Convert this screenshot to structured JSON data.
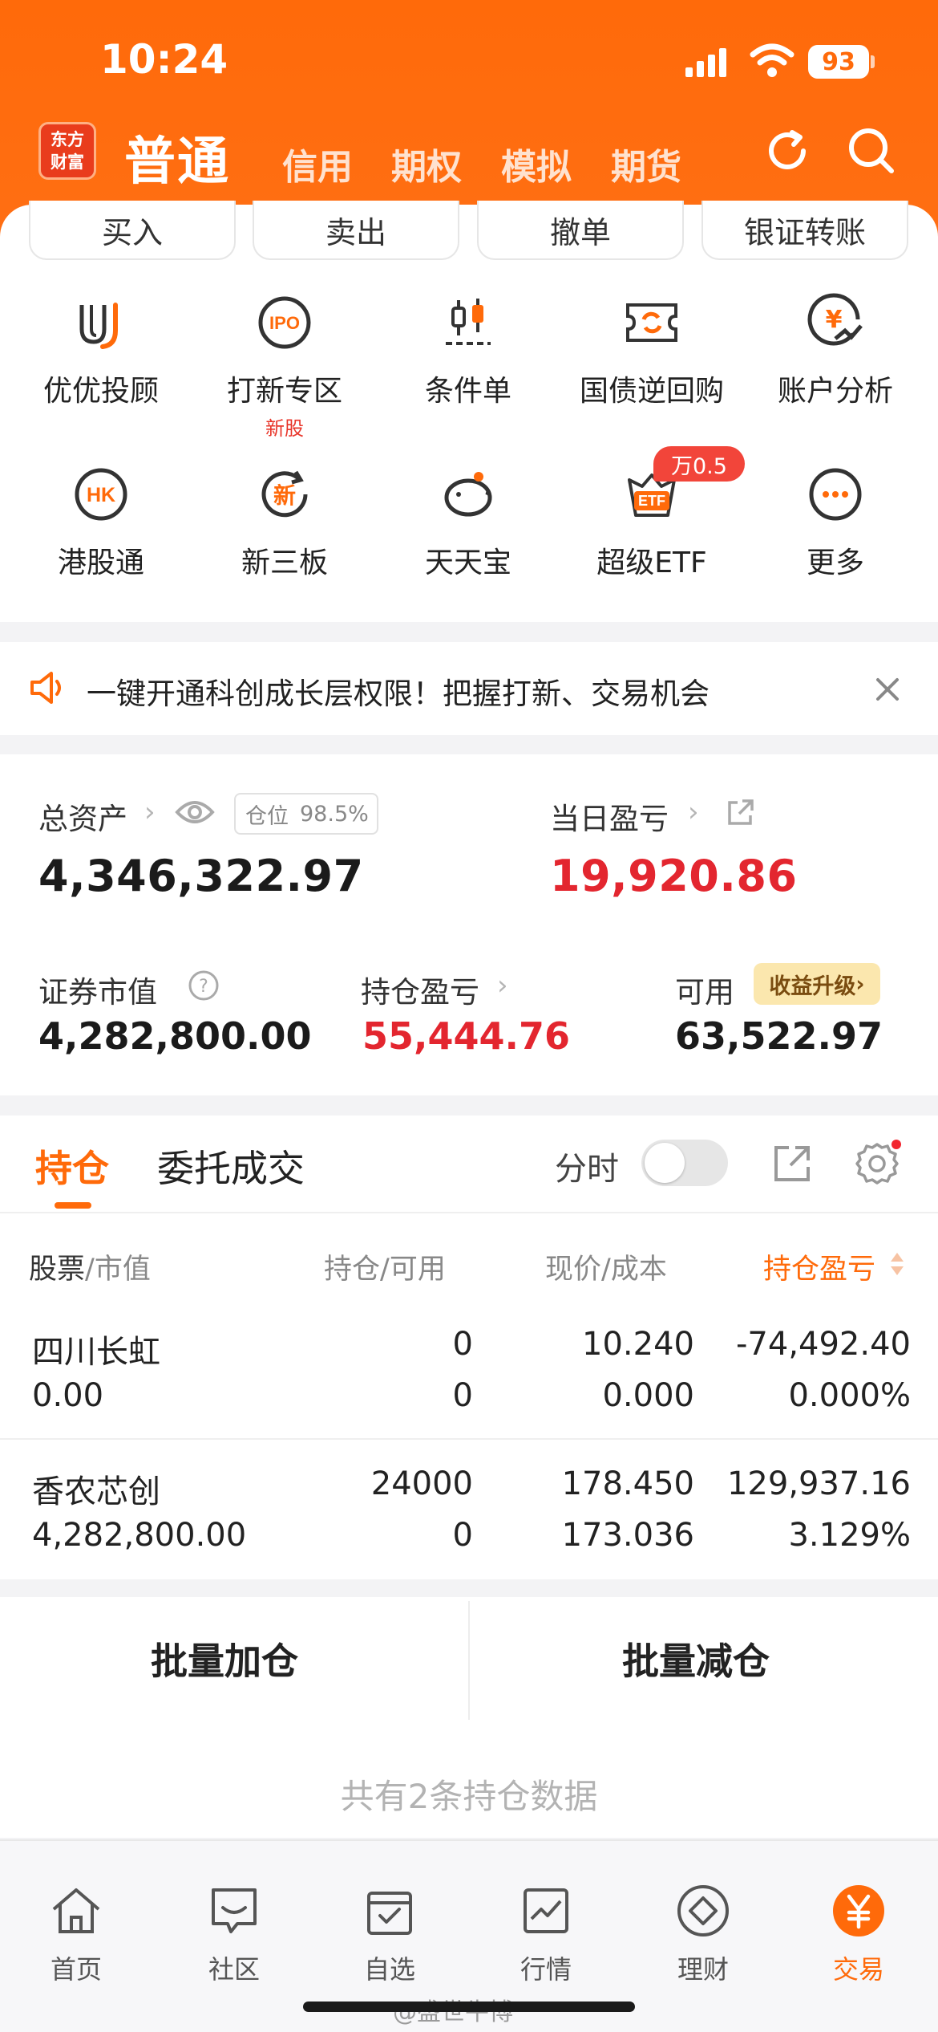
{
  "status_bar": {
    "time": "10:24",
    "battery": "93"
  },
  "header": {
    "logo_line1": "东方",
    "logo_line2": "财富",
    "active_tab": "普通",
    "tabs": [
      "信用",
      "期权",
      "模拟",
      "期货"
    ]
  },
  "quick_buttons": [
    "买入",
    "卖出",
    "撤单",
    "银证转账"
  ],
  "features": [
    {
      "label": "优优投顾",
      "icon": "uu-advisor-icon"
    },
    {
      "label": "打新专区",
      "sub": "新股",
      "icon": "ipo-icon"
    },
    {
      "label": "条件单",
      "icon": "candlestick-icon"
    },
    {
      "label": "国债逆回购",
      "icon": "repo-ticket-icon"
    },
    {
      "label": "账户分析",
      "icon": "yen-chart-icon"
    },
    {
      "label": "港股通",
      "icon": "hk-icon"
    },
    {
      "label": "新三板",
      "icon": "new-board-icon"
    },
    {
      "label": "天天宝",
      "icon": "piggy-bank-icon"
    },
    {
      "label": "超级ETF",
      "badge": "万0.5",
      "icon": "etf-icon"
    },
    {
      "label": "更多",
      "icon": "more-icon"
    }
  ],
  "notice": {
    "text": "一键开通科创成长层权限！把握打新、交易机会"
  },
  "assets": {
    "total_label": "总资产",
    "position_label": "仓位",
    "position_value": "98.5%",
    "total_value": "4,346,322.97",
    "daily_pl_label": "当日盈亏",
    "daily_pl_value": "19,920.86",
    "market_value_label": "证券市值",
    "market_value": "4,282,800.00",
    "holding_pl_label": "持仓盈亏",
    "holding_pl_value": "55,444.76",
    "available_label": "可用",
    "available_value": "63,522.97",
    "upgrade_label": "收益升级"
  },
  "holdings": {
    "tab_active": "持仓",
    "tab_other": "委托成交",
    "toggle_label": "分时",
    "columns": {
      "stock": "股票",
      "market_value": "市值",
      "holding": "持仓",
      "available": "可用",
      "price": "现价",
      "cost": "成本",
      "pl": "持仓盈亏"
    },
    "rows": [
      {
        "name": "四川长虹",
        "value": "0.00",
        "holding": "0",
        "available": "0",
        "price": "10.240",
        "cost": "0.000",
        "pl": "-74,492.40",
        "pl_pct": "0.000%",
        "trend": "down"
      },
      {
        "name": "香农芯创",
        "value": "4,282,800.00",
        "holding": "24000",
        "available": "0",
        "price": "178.450",
        "cost": "173.036",
        "pl": "129,937.16",
        "pl_pct": "3.129%",
        "trend": "up"
      }
    ],
    "batch_add": "批量加仓",
    "batch_reduce": "批量减仓",
    "footnote": "共有2条持仓数据"
  },
  "nav": [
    {
      "label": "首页",
      "icon": "home-icon"
    },
    {
      "label": "社区",
      "icon": "chat-icon"
    },
    {
      "label": "自选",
      "icon": "watchlist-icon"
    },
    {
      "label": "行情",
      "icon": "market-chart-icon"
    },
    {
      "label": "理财",
      "icon": "diamond-icon"
    },
    {
      "label": "交易",
      "icon": "yen-circle-icon",
      "active": true
    }
  ],
  "watermark": "@盛世牛博",
  "colors": {
    "brand": "#ff6a0a",
    "up": "#e3262f",
    "down": "#0f9f3b"
  }
}
